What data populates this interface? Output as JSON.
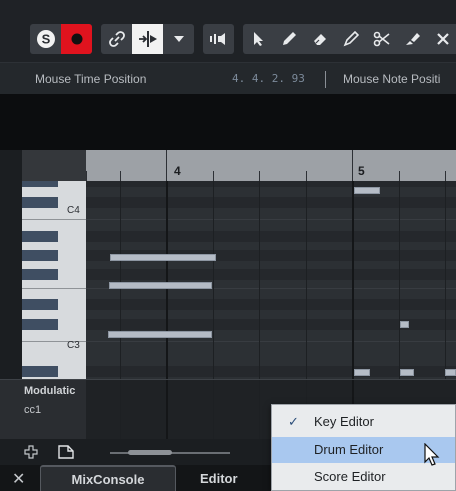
{
  "toolbar": {
    "buttons": [
      {
        "name": "solo-button",
        "icon": "solo-icon"
      },
      {
        "name": "record-button",
        "icon": "record-icon"
      },
      {
        "name": "link-button",
        "icon": "link-icon"
      },
      {
        "name": "autoscroll-button",
        "icon": "autoscroll-icon"
      },
      {
        "name": "dropdown-button",
        "icon": "chevron-down-icon"
      },
      {
        "name": "audition-button",
        "icon": "speaker-icon"
      },
      {
        "name": "object-selection-tool",
        "icon": "pointer-icon"
      },
      {
        "name": "draw-tool",
        "icon": "pencil-icon"
      },
      {
        "name": "erase-tool",
        "icon": "eraser-icon"
      },
      {
        "name": "line-tool",
        "icon": "line-tool-icon"
      },
      {
        "name": "split-tool",
        "icon": "scissors-icon"
      },
      {
        "name": "glue-tool",
        "icon": "glue-icon"
      },
      {
        "name": "mute-tool",
        "icon": "x-icon"
      }
    ],
    "colors": {
      "record": "#e0131e",
      "active": "#f2f2f2",
      "bg": "#3a3e44"
    }
  },
  "infobar": {
    "mouse_time_label": "Mouse Time Position",
    "mouse_time_value": "4. 4. 2. 93",
    "mouse_note_label": "Mouse Note Positi"
  },
  "ruler": {
    "bars": [
      "4",
      "5"
    ]
  },
  "keyboard": {
    "labels": [
      "C4",
      "C3"
    ]
  },
  "controller_lane": {
    "name": "Modulatic",
    "cc": "cc1"
  },
  "tabs": {
    "close": "✕",
    "mixconsole": "MixConsole",
    "editor": "Editor"
  },
  "context_menu": {
    "items": [
      {
        "label": "Key Editor",
        "checked": true
      },
      {
        "label": "Drum Editor",
        "checked": false,
        "hovered": true
      },
      {
        "label": "Score Editor",
        "checked": false
      }
    ],
    "check_mark": "✓"
  }
}
